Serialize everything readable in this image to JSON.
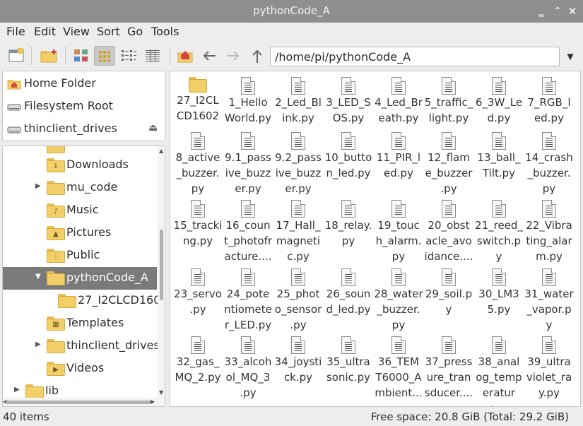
{
  "window": {
    "title": "pythonCode_A"
  },
  "menu": [
    "File",
    "Edit",
    "View",
    "Sort",
    "Go",
    "Tools"
  ],
  "toolbar": {
    "path": "/home/pi/pythonCode_A",
    "icons": [
      "new-window-icon",
      "new-folder-icon",
      "thumbnail-view-icon",
      "icon-view-icon",
      "compact-view-icon",
      "list-view-icon",
      "home-icon",
      "back-arrow-icon",
      "forward-arrow-icon",
      "up-arrow-icon"
    ]
  },
  "places": [
    {
      "label": "Home Folder",
      "icon": "home-folder-icon"
    },
    {
      "label": "Filesystem Root",
      "icon": "drive-icon"
    },
    {
      "label": "thinclient_drives",
      "icon": "drive-icon"
    }
  ],
  "tree": [
    {
      "label": "Downloads",
      "emblem": "↓"
    },
    {
      "label": "mu_code",
      "emblem": "",
      "expander": "▶"
    },
    {
      "label": "Music",
      "emblem": "♪"
    },
    {
      "label": "Pictures",
      "emblem": "▲"
    },
    {
      "label": "Public",
      "emblem": "⋮"
    },
    {
      "label": "pythonCode_A",
      "emblem": "",
      "expander": "▼"
    },
    {
      "label": "27_I2CLCD1602",
      "emblem": ""
    },
    {
      "label": "Templates",
      "emblem": "▦"
    },
    {
      "label": "thinclient_drives",
      "emblem": "",
      "expander": "▶"
    },
    {
      "label": "Videos",
      "emblem": "▶"
    },
    {
      "label": "lib",
      "emblem": "",
      "expander": "▶"
    }
  ],
  "files": [
    {
      "lines": [
        "27_I2CL",
        "CD1602"
      ],
      "type": "folder"
    },
    {
      "lines": [
        "1_Hello",
        "World.py"
      ],
      "type": "py"
    },
    {
      "lines": [
        "2_Led_Bl",
        "ink.py"
      ],
      "type": "py"
    },
    {
      "lines": [
        "3_LED_S",
        "OS.py"
      ],
      "type": "py"
    },
    {
      "lines": [
        "4_Led_Br",
        "eath.py"
      ],
      "type": "py"
    },
    {
      "lines": [
        "5_traffic_",
        "light.py"
      ],
      "type": "py"
    },
    {
      "lines": [
        "6_3W_Le",
        "d.py"
      ],
      "type": "py"
    },
    {
      "lines": [
        "7_RGB_l",
        "ed.py"
      ],
      "type": "py"
    },
    {
      "lines": [
        "8_active",
        "_buzzer.",
        "py"
      ],
      "type": "py"
    },
    {
      "lines": [
        "9.1_pass",
        "ive_buzz",
        "er.py"
      ],
      "type": "py"
    },
    {
      "lines": [
        "9.2_pass",
        "ive_buzz",
        "er.py"
      ],
      "type": "py"
    },
    {
      "lines": [
        "10_butto",
        "n_led.py"
      ],
      "type": "py"
    },
    {
      "lines": [
        "11_PIR_l",
        "ed.py"
      ],
      "type": "py"
    },
    {
      "lines": [
        "12_flam",
        "e_buzzer",
        ".py"
      ],
      "type": "py"
    },
    {
      "lines": [
        "13_ball_",
        "Tilt.py"
      ],
      "type": "py"
    },
    {
      "lines": [
        "14_crash",
        "_buzzer.",
        "py"
      ],
      "type": "py"
    },
    {
      "lines": [
        "15_tracki",
        "ng.py"
      ],
      "type": "py"
    },
    {
      "lines": [
        "16_coun",
        "t_photofr",
        "acture...."
      ],
      "type": "py"
    },
    {
      "lines": [
        "17_Hall_",
        "magneti",
        "c.py"
      ],
      "type": "py"
    },
    {
      "lines": [
        "18_relay.",
        "py"
      ],
      "type": "py"
    },
    {
      "lines": [
        "19_touc",
        "h_alarm.",
        "py"
      ],
      "type": "py"
    },
    {
      "lines": [
        "20_obst",
        "acle_avo",
        "idance...."
      ],
      "type": "py"
    },
    {
      "lines": [
        "21_reed_",
        "switch.p",
        "y"
      ],
      "type": "py"
    },
    {
      "lines": [
        "22_Vibra",
        "ting_alar",
        "m.py"
      ],
      "type": "py"
    },
    {
      "lines": [
        "23_servo",
        ".py"
      ],
      "type": "py"
    },
    {
      "lines": [
        "24_pote",
        "ntiomete",
        "r_LED.py"
      ],
      "type": "py"
    },
    {
      "lines": [
        "25_phot",
        "o_sensor",
        ".py"
      ],
      "type": "py"
    },
    {
      "lines": [
        "26_soun",
        "d_led.py"
      ],
      "type": "py"
    },
    {
      "lines": [
        "28_water",
        "_buzzer.",
        "py"
      ],
      "type": "py"
    },
    {
      "lines": [
        "29_soil.p",
        "y"
      ],
      "type": "py"
    },
    {
      "lines": [
        "30_LM3",
        "5.py"
      ],
      "type": "py"
    },
    {
      "lines": [
        "31_water",
        "_vapor.p",
        "y"
      ],
      "type": "py"
    },
    {
      "lines": [
        "32_gas_",
        "MQ_2.py"
      ],
      "type": "py"
    },
    {
      "lines": [
        "33_alcoh",
        "ol_MQ_3",
        ".py"
      ],
      "type": "py"
    },
    {
      "lines": [
        "34_joysti",
        "ck.py"
      ],
      "type": "py"
    },
    {
      "lines": [
        "35_ultra",
        "sonic.py"
      ],
      "type": "py"
    },
    {
      "lines": [
        "36_TEM",
        "T6000_A",
        "mbient..."
      ],
      "type": "py"
    },
    {
      "lines": [
        "37_press",
        "ure_tran",
        "sducer...."
      ],
      "type": "py"
    },
    {
      "lines": [
        "38_anal",
        "og_temp",
        "erature...."
      ],
      "type": "py"
    },
    {
      "lines": [
        "39_ultra",
        "violet_ra",
        "y.py"
      ],
      "type": "py"
    }
  ],
  "status": {
    "items": "40 items",
    "free": "Free space: 20.8 GiB (Total: 29.2 GiB)"
  }
}
